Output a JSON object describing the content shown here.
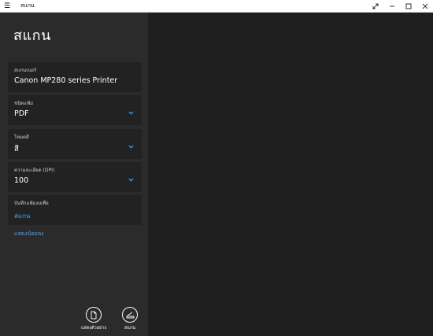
{
  "window": {
    "title": "สแกน",
    "menu_icon": "hamburger-icon",
    "controls": [
      "expand-icon",
      "minimize-icon",
      "maximize-icon",
      "close-icon"
    ]
  },
  "page_title": "สแกน",
  "fields": [
    {
      "label": "สแกนเนอร์",
      "value": "Canon MP280 series Printer",
      "has_dropdown": false
    },
    {
      "label": "ชนิดแฟ้ม",
      "value": "PDF",
      "has_dropdown": true
    },
    {
      "label": "โหมดสี",
      "value": "สี",
      "has_dropdown": true
    },
    {
      "label": "ความละเอียด (DPI)",
      "value": "100",
      "has_dropdown": true
    },
    {
      "label": "บันทึกแฟ้มลงเพื่อ",
      "value": "สแกน",
      "is_link": true
    }
  ],
  "more_link": "แสดงน้อยลง",
  "buttons": {
    "preview_label": "แสดงตัวอย่าง",
    "scan_label": "สแกน"
  },
  "colors": {
    "accent": "#4aa3ff",
    "panel": "#2b2b2b",
    "background": "#1f1f1f"
  }
}
